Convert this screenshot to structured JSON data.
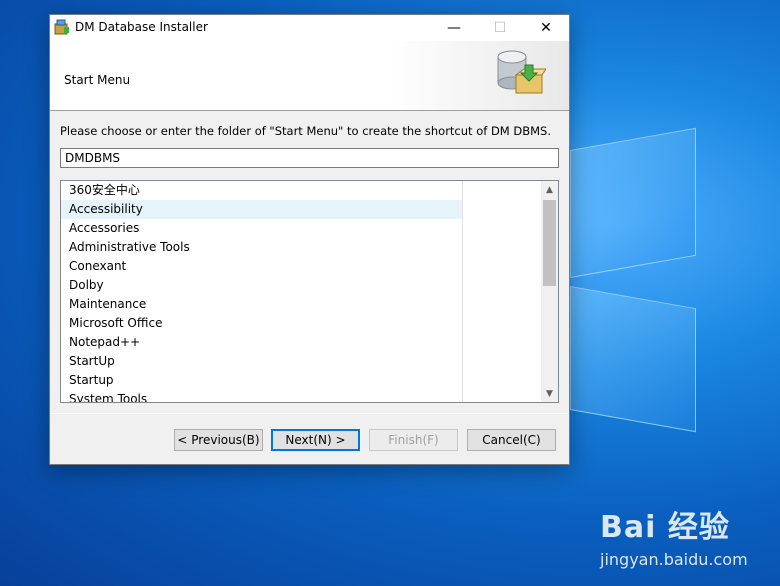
{
  "window": {
    "title": "DM Database Installer",
    "minimize_glyph": "—",
    "maximize_glyph": "☐",
    "close_glyph": "✕"
  },
  "header": {
    "title": "Start Menu"
  },
  "instruction": "Please choose or enter the folder of \"Start Menu\" to create the shortcut of DM DBMS.",
  "folder_input": {
    "value": "DMDBMS"
  },
  "folder_list": {
    "items": [
      "360安全中心",
      "Accessibility",
      "Accessories",
      "Administrative Tools",
      "Conexant",
      "Dolby",
      "Maintenance",
      "Microsoft Office",
      "Notepad++",
      "StartUp",
      "Startup",
      "System Tools"
    ],
    "hovered_index": 1
  },
  "buttons": {
    "previous": "< Previous(B)",
    "next": "Next(N) >",
    "finish": "Finish(F)",
    "cancel": "Cancel(C)"
  },
  "watermark": {
    "brand": "Bai 经验",
    "url": "jingyan.baidu.com"
  },
  "colors": {
    "desktop_blue": "#0a5fbf",
    "focus_border": "#0078d7",
    "hover_row": "#e5f3fb"
  }
}
